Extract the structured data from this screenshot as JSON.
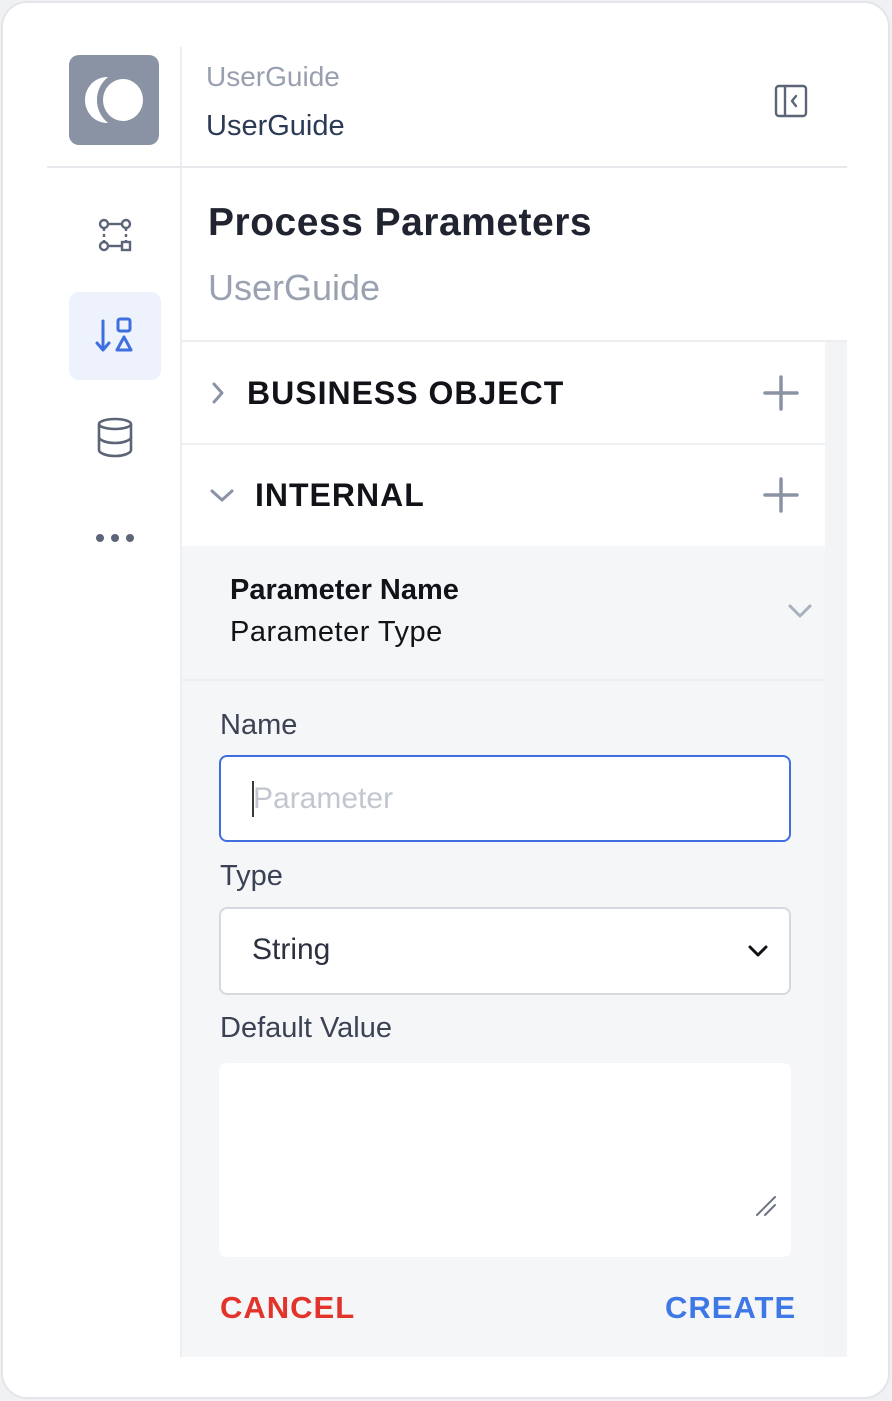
{
  "header": {
    "workspace_name": "UserGuide",
    "workspace_title": "UserGuide"
  },
  "rail": {
    "items": [
      {
        "name": "process-flow",
        "icon": "flow-nodes-icon"
      },
      {
        "name": "process-parameters",
        "icon": "sort-shapes-icon",
        "active": true
      },
      {
        "name": "data",
        "icon": "database-icon"
      },
      {
        "name": "more",
        "icon": "more-dots-icon"
      }
    ]
  },
  "panel": {
    "title": "Process Parameters",
    "subtitle": "UserGuide"
  },
  "sections": [
    {
      "label": "BUSINESS OBJECT",
      "expanded": false
    },
    {
      "label": "INTERNAL",
      "expanded": true
    }
  ],
  "parameter_header": {
    "name_col": "Parameter Name",
    "type_col": "Parameter Type"
  },
  "form": {
    "name_label": "Name",
    "name_placeholder": "Parameter",
    "name_value": "",
    "type_label": "Type",
    "type_value": "String",
    "default_label": "Default Value",
    "default_value": "",
    "cancel_label": "CANCEL",
    "create_label": "CREATE"
  },
  "colors": {
    "accent": "#3e78e6",
    "danger": "#e2342b",
    "logo_bg": "#8a93a4",
    "active_rail_bg": "#edf2fd"
  }
}
